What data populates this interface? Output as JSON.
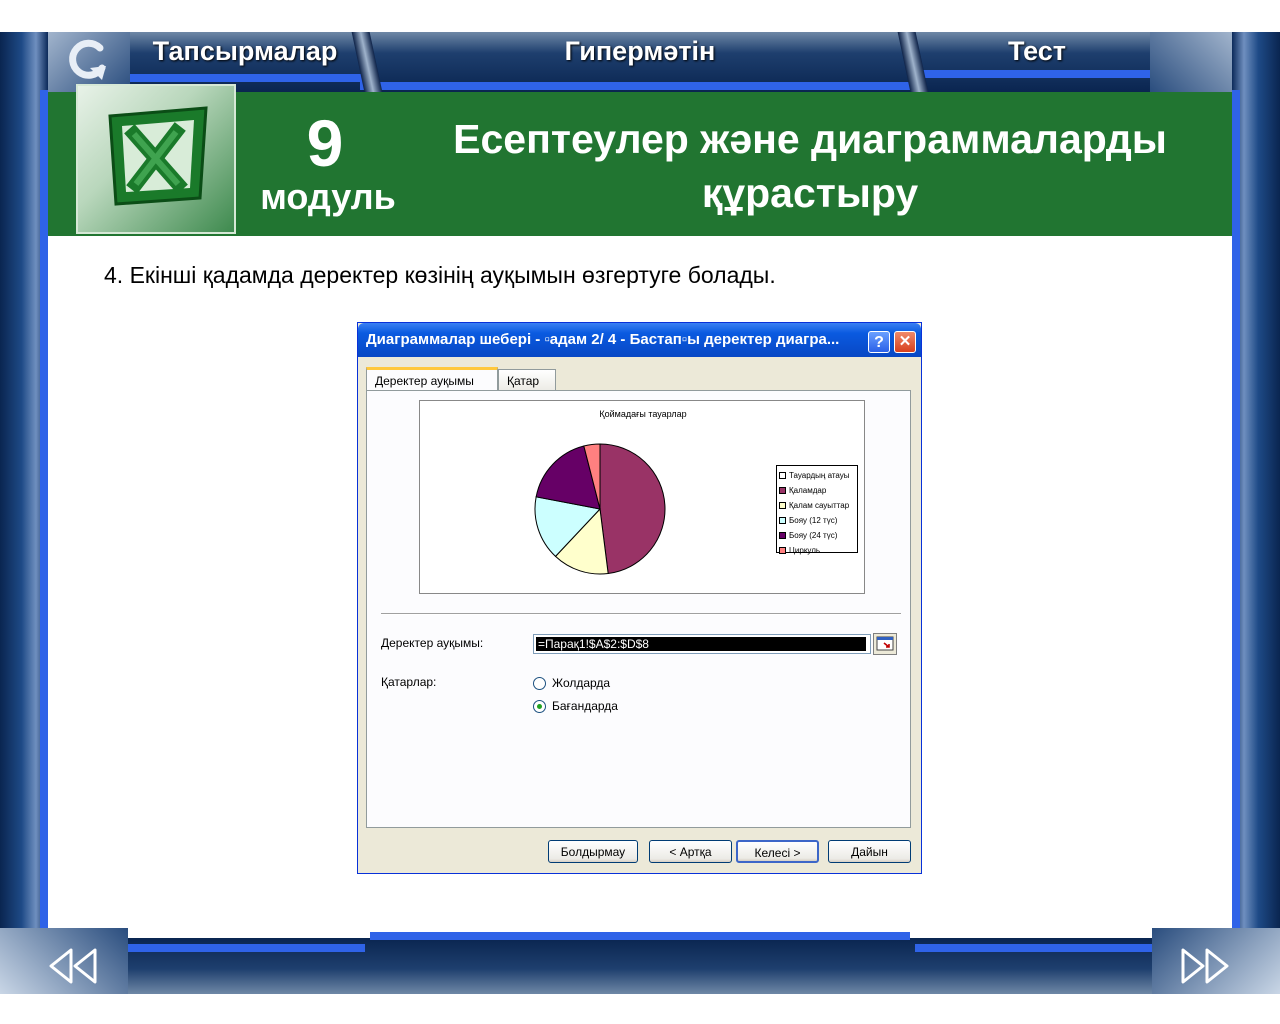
{
  "nav": {
    "tasks": "Тапсырмалар",
    "hypertext": "Гипермәтін",
    "test": "Тест"
  },
  "header": {
    "module_number": "9",
    "module_word": "модуль",
    "title_line1": "Есептеулер және диаграммаларды",
    "title_line2": "құрастыру"
  },
  "instruction": "4. Екінші қадамда деректер көзінің ауқымын өзгертуге болады.",
  "dialog": {
    "title": "Диаграммалар шебері - ▫адам 2/ 4 - Бастап▫ы деректер диагра...",
    "help": "?",
    "close": "✕",
    "tabs": [
      "Деректер ауқымы",
      "Қатар"
    ],
    "range_label": "Деректер ауқымы:",
    "range_value": "=Парақ1!$A$2:$D$8",
    "series_label": "Қатарлар:",
    "radio_rows": "Жолдарда",
    "radio_columns": "Бағандарда",
    "buttons": {
      "cancel": "Болдырмау",
      "back": "< Артқа",
      "next": "Келесі >",
      "finish": "Дайын"
    }
  },
  "chart_data": {
    "type": "pie",
    "title": "Қоймадағы тауарлар",
    "categories": [
      "Тауардың атауы",
      "Қаламдар",
      "Қалам сауыттар",
      "Бояу (12 түс)",
      "Бояу (24 түс)",
      "Циркуль"
    ],
    "values": [
      0,
      48,
      14,
      16,
      18,
      4
    ],
    "colors": [
      "#ffffff",
      "#993366",
      "#ffffcc",
      "#ccffff",
      "#660066",
      "#ff8080"
    ],
    "legend_position": "right"
  }
}
